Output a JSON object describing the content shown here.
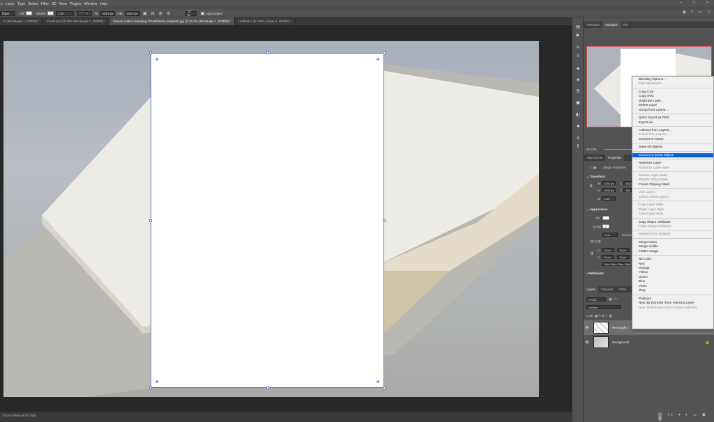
{
  "menu": [
    "Layer",
    "Type",
    "Select",
    "Filter",
    "3D",
    "View",
    "Plugins",
    "Window",
    "Help"
  ],
  "menu_prefix": "e",
  "window_controls": [
    "–",
    "□",
    "×"
  ],
  "options": {
    "tool": "hape",
    "fill_label": "Fill:",
    "stroke_label": "Stroke:",
    "stroke_width": "1 px",
    "w_label": "W:",
    "w_value": "2391 px",
    "go": "GO",
    "h_label": "H:",
    "h_value": "3423 px",
    "radius": "10 px",
    "align_edges": "Align Edges"
  },
  "tabs": [
    {
      "label": "% (Rectangle 1, RGB/8) *",
      "active": false
    },
    {
      "label": "Final1.psd @ 25% (Rectangle 1, RGB/8) *",
      "active": false
    },
    {
      "label": "brando-makes-branding-TPuWhSmfo-unsplash.jpg @ 33.3% (Rectangle 1, RGB/8) *",
      "active": true
    },
    {
      "label": "Untitled-1 @ 100% (Layer 1, RGB/8) *",
      "active": false
    }
  ],
  "status": "72 px x 3648 px (72 ppi)",
  "panel": {
    "top_tabs": [
      "Histogram",
      "Navigator",
      "Info"
    ],
    "zoom": "33.33%",
    "prop_tabs": [
      "Adjustments",
      "Properties"
    ],
    "shape_properties": "Shape Properties",
    "transform": "Transform",
    "w": "2391 px",
    "h": "3423 px",
    "x": "1823",
    "y": "135",
    "angle": "0.00°",
    "appearance": "Appearance",
    "fill": "Fill",
    "stroke": "Stroke",
    "stroke_w": "1 px",
    "corner1": "10 px",
    "corner2": "10 px",
    "corner3": "10 px",
    "corner4": "10 px",
    "corners_all": "10px,10px,10px,10px",
    "pathfinder": "Pathfinder",
    "layer_tabs": [
      "Layers",
      "Channels",
      "Paths"
    ],
    "kind": "Kind",
    "blend": "Normal",
    "lock": "Lock:",
    "layers": [
      {
        "name": "Rectangle 1"
      },
      {
        "name": "Background"
      }
    ]
  },
  "context_menu": [
    {
      "label": "Blending Options...",
      "state": "normal"
    },
    {
      "label": "Edit Adjustment...",
      "state": "disabled"
    },
    {
      "sep": true
    },
    {
      "label": "Copy CSS",
      "state": "normal"
    },
    {
      "label": "Copy SVG",
      "state": "normal"
    },
    {
      "label": "Duplicate Layer...",
      "state": "normal"
    },
    {
      "label": "Delete Layer",
      "state": "normal"
    },
    {
      "label": "Group from Layers...",
      "state": "normal"
    },
    {
      "sep": true
    },
    {
      "label": "Quick Export as PNG",
      "state": "normal"
    },
    {
      "label": "Export As...",
      "state": "normal"
    },
    {
      "sep": true
    },
    {
      "label": "Artboard from Layers...",
      "state": "normal"
    },
    {
      "label": "Frame from Layers...",
      "state": "disabled"
    },
    {
      "label": "Convert to Frame",
      "state": "normal"
    },
    {
      "sep": true
    },
    {
      "label": "Mask All Objects",
      "state": "normal"
    },
    {
      "sep": true
    },
    {
      "label": "Convert to Smart Object",
      "state": "highlighted"
    },
    {
      "sep": true
    },
    {
      "label": "Rasterize Layer",
      "state": "normal"
    },
    {
      "label": "Rasterize Layer Style",
      "state": "disabled"
    },
    {
      "sep": true
    },
    {
      "label": "Disable Layer Mask",
      "state": "disabled"
    },
    {
      "label": "Disable Vector Mask",
      "state": "disabled"
    },
    {
      "label": "Create Clipping Mask",
      "state": "normal"
    },
    {
      "sep": true
    },
    {
      "label": "Link Layers",
      "state": "disabled"
    },
    {
      "label": "Select Linked Layers",
      "state": "disabled"
    },
    {
      "sep": true
    },
    {
      "label": "Copy Layer Style",
      "state": "disabled"
    },
    {
      "label": "Paste Layer Style",
      "state": "disabled"
    },
    {
      "label": "Clear Layer Style",
      "state": "disabled"
    },
    {
      "sep": true
    },
    {
      "label": "Copy Shape Attributes",
      "state": "normal"
    },
    {
      "label": "Paste Shape Attributes",
      "state": "disabled"
    },
    {
      "sep": true
    },
    {
      "label": "Release from Isolation",
      "state": "disabled"
    },
    {
      "sep": true
    },
    {
      "label": "Merge Down",
      "state": "normal"
    },
    {
      "label": "Merge Visible",
      "state": "normal"
    },
    {
      "label": "Flatten Image",
      "state": "normal"
    },
    {
      "sep": true
    },
    {
      "label": "No Color",
      "state": "normal"
    },
    {
      "label": "Red",
      "state": "normal"
    },
    {
      "label": "Orange",
      "state": "normal"
    },
    {
      "label": "Yellow",
      "state": "normal"
    },
    {
      "label": "Green",
      "state": "normal"
    },
    {
      "label": "Blue",
      "state": "normal"
    },
    {
      "label": "Violet",
      "state": "normal"
    },
    {
      "label": "Gray",
      "state": "normal"
    },
    {
      "sep": true
    },
    {
      "label": "Postcard",
      "state": "normal"
    },
    {
      "label": "New 3D Extrusion from Selected Layer",
      "state": "normal"
    },
    {
      "label": "New 3D Extrusion from Current Selection",
      "state": "disabled"
    }
  ]
}
